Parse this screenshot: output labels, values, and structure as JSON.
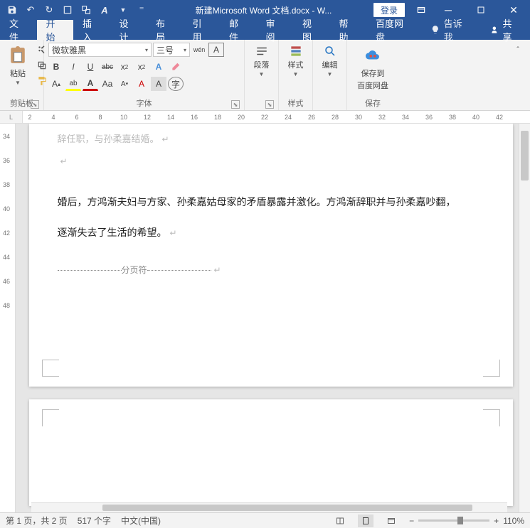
{
  "titlebar": {
    "title": "新建Microsoft Word 文档.docx - W...",
    "login": "登录"
  },
  "qat": {
    "save": "💾",
    "undo": "↶",
    "redo": "↷"
  },
  "tabs": {
    "file": "文件",
    "home": "开始",
    "insert": "插入",
    "design": "设计",
    "layout": "布局",
    "references": "引用",
    "mail": "邮件",
    "review": "审阅",
    "view": "视图",
    "help": "帮助",
    "baidu": "百度网盘",
    "tell": "告诉我",
    "share": "共享"
  },
  "ribbon": {
    "clipboard": {
      "label": "剪贴板",
      "paste": "粘贴"
    },
    "font": {
      "label": "字体",
      "name": "微软雅黑",
      "size": "三号",
      "bold": "B",
      "italic": "I",
      "underline": "U",
      "strike": "abc",
      "sub": "x₂",
      "sup": "x²",
      "clear": "A",
      "phonetic": "wén",
      "charborder": "A"
    },
    "para": {
      "label": "段落",
      "btn": "段落"
    },
    "styles": {
      "label": "样式",
      "btn": "样式"
    },
    "editing": {
      "btn": "编辑"
    },
    "save": {
      "label": "保存",
      "btn1": "保存到",
      "btn2": "百度网盘"
    }
  },
  "ruler": {
    "marks": [
      2,
      4,
      6,
      8,
      10,
      12,
      14,
      16,
      18,
      20,
      22,
      24,
      26,
      28,
      30,
      32,
      34,
      36,
      38,
      40,
      42
    ]
  },
  "vruler": {
    "marks": [
      34,
      36,
      38,
      40,
      42,
      44,
      46,
      48
    ]
  },
  "doc": {
    "line0": "辞任职，与孙柔嘉结婚。",
    "line1": "婚后，方鸿渐夫妇与方家、孙柔嘉姑母家的矛盾暴露并激化。方鸿渐辞职并与孙柔嘉吵翻，",
    "line2": "逐渐失去了生活的希望。",
    "pagebreak": "分页符"
  },
  "status": {
    "page": "第 1 页，共 2 页",
    "words": "517 个字",
    "lang": "中文(中国)",
    "zoom": "110%"
  }
}
